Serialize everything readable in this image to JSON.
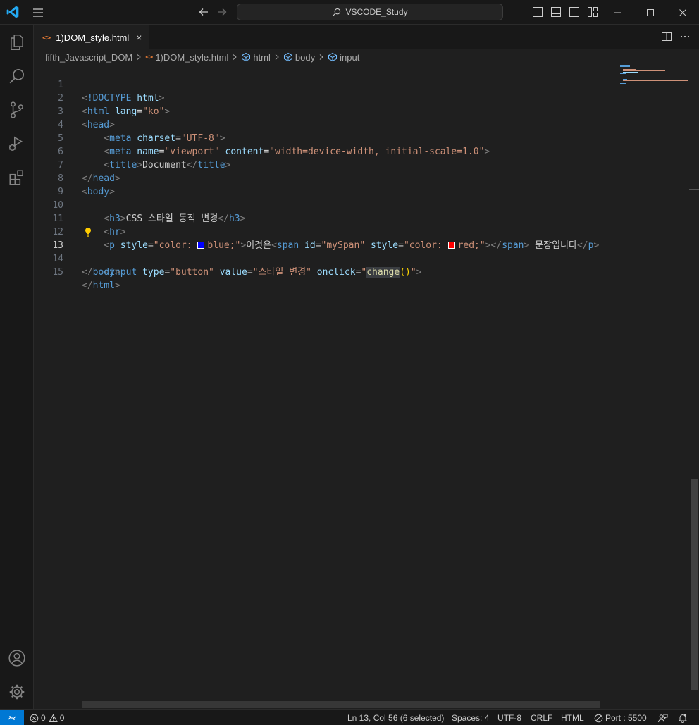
{
  "titlebar": {
    "search_text": "VSCODE_Study"
  },
  "tab": {
    "icon_text": "<>",
    "label": "1)DOM_style.html",
    "close": "×"
  },
  "breadcrumb": {
    "folder": "fifth_Javascript_DOM",
    "file": "1)DOM_style.html",
    "items": [
      "html",
      "body",
      "input"
    ]
  },
  "editor": {
    "active_line": 13,
    "lines": [
      {
        "n": "1"
      },
      {
        "n": "2"
      },
      {
        "n": "3"
      },
      {
        "n": "4"
      },
      {
        "n": "5"
      },
      {
        "n": "6"
      },
      {
        "n": "7"
      },
      {
        "n": "8"
      },
      {
        "n": "9"
      },
      {
        "n": "10"
      },
      {
        "n": "11"
      },
      {
        "n": "12"
      },
      {
        "n": "13"
      },
      {
        "n": "14"
      },
      {
        "n": "15"
      }
    ],
    "code": {
      "doctype": "!DOCTYPE",
      "html": "html",
      "lang_attr": "lang",
      "lang_val": "\"ko\"",
      "head": "head",
      "meta": "meta",
      "charset_attr": "charset",
      "charset_val": "\"UTF-8\"",
      "name_attr": "name",
      "name_val": "\"viewport\"",
      "content_attr": "content",
      "content_val": "\"width=device-width, initial-scale=1.0\"",
      "title": "title",
      "title_text": "Document",
      "body": "body",
      "h3": "h3",
      "h3_text": "CSS 스타일 동적 변경",
      "hr": "hr",
      "p": "p",
      "style_attr": "style",
      "p_style_open": "\"color: ",
      "p_style_close": "blue;\"",
      "p_text1": "이것은",
      "span": "span",
      "id_attr": "id",
      "id_val": "\"mySpan\"",
      "span_style_open": "\"color: ",
      "span_style_close": "red;\"",
      "p_text2": " 문장입니다",
      "input": "input",
      "type_attr": "type",
      "type_val": "\"button\"",
      "value_attr": "value",
      "value_val": "\"스타일 변경\"",
      "onclick_attr": "onclick",
      "onclick_q1": "\"",
      "onclick_fn": "change",
      "onclick_paren": "()",
      "onclick_q2": "\""
    }
  },
  "statusbar": {
    "errors": "0",
    "warnings": "0",
    "position": "Ln 13, Col 56 (6 selected)",
    "spaces": "Spaces: 4",
    "encoding": "UTF-8",
    "eol": "CRLF",
    "language": "HTML",
    "port": "Port : 5500"
  },
  "colors": {
    "accent": "#0078d4",
    "swatch_blue": "#0000ff",
    "swatch_red": "#ff0000"
  }
}
